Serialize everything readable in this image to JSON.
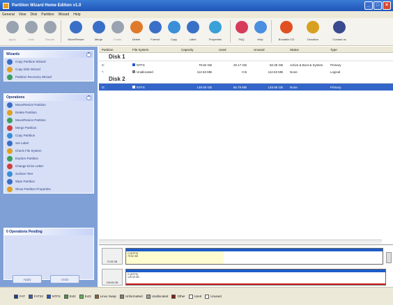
{
  "window": {
    "title": "Partition Wizard Home Edition v1.0"
  },
  "menu": [
    "General",
    "View",
    "Disk",
    "Partition",
    "Wizard",
    "Help"
  ],
  "toolbar": [
    {
      "label": "Apply",
      "color": "#9aa3b0",
      "disabled": true
    },
    {
      "label": "Undo",
      "color": "#9aa3b0",
      "disabled": true
    },
    {
      "label": "Discard",
      "color": "#9aa3b0",
      "disabled": true
    },
    {
      "label": "Move/Resize",
      "color": "#3a6fc8",
      "disabled": false,
      "wide": true
    },
    {
      "label": "Merge",
      "color": "#3a6fc8",
      "disabled": false
    },
    {
      "label": "Create",
      "color": "#9aa3b0",
      "disabled": true
    },
    {
      "label": "Delete",
      "color": "#e07a2a",
      "disabled": false
    },
    {
      "label": "Format",
      "color": "#3a6fc8",
      "disabled": false
    },
    {
      "label": "Copy",
      "color": "#3a8fd8",
      "disabled": false
    },
    {
      "label": "Label",
      "color": "#3a6fc8",
      "disabled": false
    },
    {
      "label": "Properties",
      "color": "#3aa0d8",
      "disabled": false,
      "wide": true
    },
    {
      "label": "FAQ",
      "color": "#d83a5a",
      "disabled": false
    },
    {
      "label": "Help",
      "color": "#4a8fe0",
      "disabled": false
    },
    {
      "label": "Bootable CD",
      "color": "#e05020",
      "disabled": false,
      "wide": true
    },
    {
      "label": "Donation",
      "color": "#d8a020",
      "disabled": false,
      "wide": true
    },
    {
      "label": "Contact us",
      "color": "#3a4a90",
      "disabled": false,
      "wide": true
    }
  ],
  "wizards": {
    "title": "Wizards",
    "items": [
      "Copy Partition Wizard",
      "Copy Disk Wizard",
      "Partition Recovery Wizard"
    ]
  },
  "operations": {
    "title": "Operations",
    "items": [
      "Move/Resize Partition",
      "Delete Partition",
      "Move/Resize Partition",
      "Merge Partition",
      "Copy Partition",
      "Set Label",
      "Check File System",
      "Explore Partition",
      "Change Drive Letter",
      "Surface Test",
      "Wipe Partition",
      "Show Partition Properties"
    ]
  },
  "pending": {
    "title": "0 Operations Pending"
  },
  "left_buttons": {
    "apply": "Apply",
    "undo": "Undo"
  },
  "columns": [
    "Partition",
    "File System",
    "Capacity",
    "Used",
    "Unused",
    "Status",
    "Type"
  ],
  "disks": [
    {
      "title": "Disk 1",
      "rows": [
        {
          "partition": "C:",
          "fs": "NTFS",
          "fs_color": "#2255cc",
          "capacity": "79.92 GB",
          "used": "20.17 GB",
          "unused": "50.35 GB",
          "status": "Active & Boot & System",
          "type": "Primary",
          "selected": false
        },
        {
          "partition": "*:",
          "fs": "Unallocated",
          "fs_color": "#777777",
          "capacity": "112.53 MB",
          "used": "0 B",
          "unused": "112.53 MB",
          "status": "None",
          "type": "Logical",
          "selected": false
        }
      ]
    },
    {
      "title": "Disk 2",
      "rows": [
        {
          "partition": "G:",
          "fs": "NTFS",
          "fs_color": "#ffffff",
          "capacity": "149.05 GB",
          "used": "56.79 MB",
          "unused": "148.99 GB",
          "status": "None",
          "type": "Primary",
          "selected": true
        }
      ]
    }
  ],
  "diskmap": [
    {
      "disk_label": "74.53 GB",
      "part_label": "C:(NTFS)",
      "part_size": "79.92 GB"
    },
    {
      "disk_label": "149.05 GB",
      "part_label": "G:(NTFS)",
      "part_size": "149.05 GB"
    }
  ],
  "legend": [
    {
      "label": "FAT",
      "color": "#1f3f8f"
    },
    {
      "label": "FAT32",
      "color": "#3a5fb0"
    },
    {
      "label": "NTFS",
      "color": "#2255cc"
    },
    {
      "label": "Ext2",
      "color": "#4a9040"
    },
    {
      "label": "Ext3",
      "color": "#6ab060"
    },
    {
      "label": "Linux Swap",
      "color": "#906030"
    },
    {
      "label": "Unformatted",
      "color": "#808080"
    },
    {
      "label": "Unallocated",
      "color": "#a0a0a0"
    },
    {
      "label": "Other",
      "color": "#802020"
    },
    {
      "label": "Used",
      "color": "#ffffff"
    },
    {
      "label": "Unused",
      "color": "#ffffff"
    }
  ]
}
